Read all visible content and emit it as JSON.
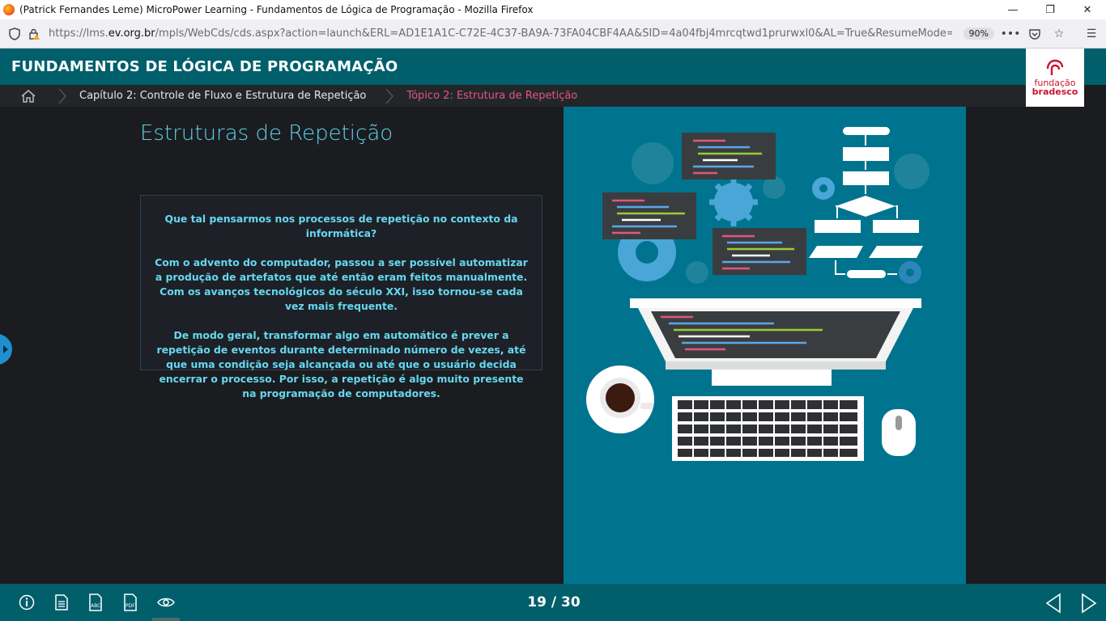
{
  "browser": {
    "window_title": "(Patrick Fernandes Leme) MicroPower Learning - Fundamentos de Lógica de Programação - Mozilla Firefox",
    "url_prefix": "https://lms.",
    "url_host": "ev.org.br",
    "url_rest": "/mpls/WebCds/cds.aspx?action=launch&ERL=AD1E1A1C-C72E-4C37-BA9A-73FA04CBF4AA&SID=4a04fbj4mrcqtwd1prurwxl0&AL=True&ResumeMode=CP&D",
    "zoom": "90%"
  },
  "app": {
    "title": "FUNDAMENTOS DE LÓGICA DE PROGRAMAÇÃO",
    "logo_line1": "fundação",
    "logo_line2": "bradesco"
  },
  "breadcrumb": {
    "chapter": "Capítulo 2: Controle de Fluxo e Estrutura de Repetição",
    "topic": "Tópico 2: Estrutura de Repetição"
  },
  "content": {
    "heading": "Estruturas de Repetição",
    "paragraphs": [
      "Que tal pensarmos nos processos de repetição no contexto da informática?",
      "Com o advento do computador, passou a ser possível automatizar a produção de artefatos que até então eram feitos manualmente. Com os avanços tecnológicos do século XXI, isso tornou-se cada vez mais frequente.",
      "De modo geral, transformar algo em automático é prever a repetição de eventos durante determinado número de vezes, até que uma condição seja alcançada ou até que o usuário decida encerrar o processo. Por isso, a repetição é algo muito presente na programação de computadores."
    ]
  },
  "footer": {
    "pager": "19 / 30"
  },
  "colors": {
    "header_bg": "#005f6b",
    "heading_text": "#5ed2ee",
    "topic_pink": "#e2567e",
    "illustration_bg": "#00748e"
  }
}
